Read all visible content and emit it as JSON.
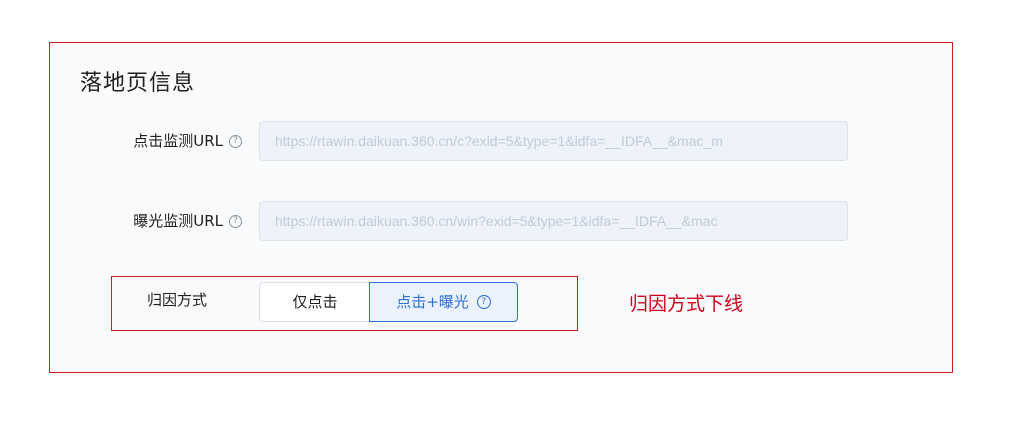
{
  "section": {
    "title": "落地页信息"
  },
  "click_monitor": {
    "label": "点击监测URL",
    "value": "https://rtawin.daikuan.360.cn/c?exid=5&type=1&idfa=__IDFA__&mac_m"
  },
  "impression_monitor": {
    "label": "曝光监测URL",
    "value": "https://rtawin.daikuan.360.cn/win?exid=5&type=1&idfa=__IDFA__&mac"
  },
  "attribution": {
    "label": "归因方式",
    "options": [
      "仅点击",
      "点击+曝光"
    ],
    "selected": "点击+曝光"
  },
  "annotation": {
    "text": "归因方式下线"
  },
  "colors": {
    "highlight_border": "#c81e1e",
    "annotation_text": "#d0021b",
    "primary": "#2f6fd6"
  },
  "icons": {
    "help": "question-circle-icon"
  }
}
